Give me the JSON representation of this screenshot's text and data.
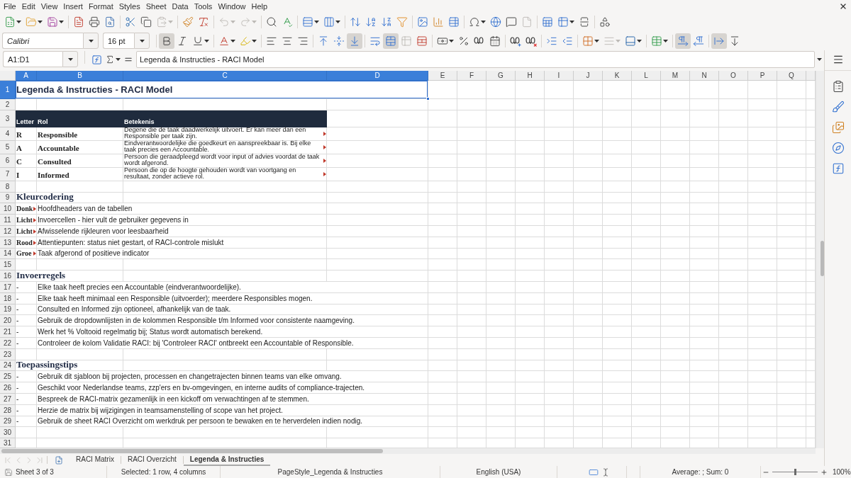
{
  "menu_bar": {
    "items": [
      "File",
      "Edit",
      "View",
      "Insert",
      "Format",
      "Styles",
      "Sheet",
      "Data",
      "Tools",
      "Window",
      "Help"
    ]
  },
  "standard_toolbar": {
    "paste_enabled": false,
    "undo_enabled": false,
    "redo_enabled": false,
    "page_enabled": false
  },
  "formatting_toolbar": {
    "font_name": "Calibri",
    "font_size": "16 pt",
    "bold": true,
    "italic": false,
    "underline": false,
    "align_left": false,
    "align_center": false,
    "align_right": false,
    "align_top": false,
    "align_middle": false,
    "align_bottom": true,
    "wrap_text": false,
    "merge_center": true,
    "merge_enabled": false,
    "border_style_enabled": false,
    "left_to_right": true,
    "right_to_left": false,
    "text_horizontal": true,
    "text_vertical": false
  },
  "formula_bar": {
    "name_box": "A1:D1",
    "formula": "Legenda & Instructies - RACI Model"
  },
  "sheet": {
    "columns": [
      {
        "label": "A",
        "selected": true
      },
      {
        "label": "B",
        "selected": true
      },
      {
        "label": "C",
        "selected": true
      },
      {
        "label": "D",
        "selected": true
      },
      {
        "label": "E",
        "selected": false
      },
      {
        "label": "F",
        "selected": false
      },
      {
        "label": "G",
        "selected": false
      },
      {
        "label": "H",
        "selected": false
      },
      {
        "label": "I",
        "selected": false
      },
      {
        "label": "J",
        "selected": false
      },
      {
        "label": "K",
        "selected": false
      },
      {
        "label": "L",
        "selected": false
      },
      {
        "label": "M",
        "selected": false
      },
      {
        "label": "N",
        "selected": false
      },
      {
        "label": "O",
        "selected": false
      },
      {
        "label": "P",
        "selected": false
      },
      {
        "label": "Q",
        "selected": false
      }
    ],
    "rows": [
      {
        "number": "1",
        "selected": true,
        "kind": "title",
        "text": "Legenda & Instructies - RACI Model"
      },
      {
        "number": "2",
        "selected": false,
        "kind": "blank"
      },
      {
        "number": "3",
        "selected": false,
        "kind": "table_header",
        "cells": [
          "Letter",
          "Rol",
          "Betekenis"
        ]
      },
      {
        "number": "4",
        "selected": false,
        "kind": "role",
        "letter": "R",
        "role": "Responsible",
        "meaning": "Degene die de taak daadwerkelijk uitvoert. Er kan meer dan een Responsible per taak zijn.",
        "clipped": true
      },
      {
        "number": "5",
        "selected": false,
        "kind": "role",
        "letter": "A",
        "role": "Accountable",
        "meaning": "Eindverantwoordelijke die goedkeurt en aanspreekbaar is. Bij elke taak precies een Accountable.",
        "clipped": true
      },
      {
        "number": "6",
        "selected": false,
        "kind": "role",
        "letter": "C",
        "role": "Consulted",
        "meaning": "Persoon die geraadpleegd wordt voor input of advies voordat de taak wordt afgerond.",
        "clipped": true
      },
      {
        "number": "7",
        "selected": false,
        "kind": "role",
        "letter": "I",
        "role": "Informed",
        "meaning": "Persoon die op de hoogte gehouden wordt van voortgang en resultaat, zonder actieve rol.",
        "clipped": true
      },
      {
        "number": "8",
        "selected": false,
        "kind": "blank"
      },
      {
        "number": "9",
        "selected": false,
        "kind": "section",
        "text": "Kleurcodering"
      },
      {
        "number": "10",
        "selected": false,
        "kind": "color_key",
        "label": "Donk",
        "description": "Hoofdheaders van de tabellen",
        "clipped": true
      },
      {
        "number": "11",
        "selected": false,
        "kind": "color_key",
        "label": "Licht",
        "description": "Invoercellen - hier vult de gebruiker gegevens in",
        "clipped": true
      },
      {
        "number": "12",
        "selected": false,
        "kind": "color_key",
        "label": "Licht",
        "description": "Afwisselende rijkleuren voor leesbaarheid",
        "clipped": true
      },
      {
        "number": "13",
        "selected": false,
        "kind": "color_key",
        "label": "Rood",
        "description": "Attentiepunten: status niet gestart, of RACI-controle mislukt",
        "clipped": true
      },
      {
        "number": "14",
        "selected": false,
        "kind": "color_key",
        "label": "Groe",
        "description": "Taak afgerond of positieve indicator",
        "clipped": true
      },
      {
        "number": "15",
        "selected": false,
        "kind": "blank"
      },
      {
        "number": "16",
        "selected": false,
        "kind": "section",
        "text": "Invoerregels"
      },
      {
        "number": "17",
        "selected": false,
        "kind": "bullet",
        "marker": "-",
        "text": "Elke taak heeft precies een Accountable (eindverantwoordelijke)."
      },
      {
        "number": "18",
        "selected": false,
        "kind": "bullet",
        "marker": "-",
        "text": "Elke taak heeft minimaal een Responsible (uitvoerder); meerdere Responsibles mogen."
      },
      {
        "number": "19",
        "selected": false,
        "kind": "bullet",
        "marker": "-",
        "text": "Consulted en Informed zijn optioneel, afhankelijk van de taak."
      },
      {
        "number": "20",
        "selected": false,
        "kind": "bullet",
        "marker": "-",
        "text": "Gebruik de dropdownlijsten in de kolommen Responsible t/m Informed voor consistente naamgeving."
      },
      {
        "number": "21",
        "selected": false,
        "kind": "bullet",
        "marker": "-",
        "text": "Werk het % Voltooid regelmatig bij; Status wordt automatisch berekend."
      },
      {
        "number": "22",
        "selected": false,
        "kind": "bullet",
        "marker": "-",
        "text": "Controleer de kolom Validatie RACI: bij 'Controleer RACI' ontbreekt een Accountable of Responsible."
      },
      {
        "number": "23",
        "selected": false,
        "kind": "blank"
      },
      {
        "number": "24",
        "selected": false,
        "kind": "section",
        "text": "Toepassingstips"
      },
      {
        "number": "25",
        "selected": false,
        "kind": "bullet",
        "marker": "-",
        "text": "Gebruik dit sjabloon bij projecten, processen en changetrajecten binnen teams van elke omvang."
      },
      {
        "number": "26",
        "selected": false,
        "kind": "bullet",
        "marker": "-",
        "text": "Geschikt voor Nederlandse teams, zzp'ers en bv-omgevingen, en interne audits of compliance-trajecten."
      },
      {
        "number": "27",
        "selected": false,
        "kind": "bullet",
        "marker": "-",
        "text": "Bespreek de RACI-matrix gezamenlijk in een kickoff om verwachtingen af te stemmen."
      },
      {
        "number": "28",
        "selected": false,
        "kind": "bullet",
        "marker": "-",
        "text": "Herzie de matrix bij wijzigingen in teamsamenstelling of scope van het project."
      },
      {
        "number": "29",
        "selected": false,
        "kind": "bullet",
        "marker": "-",
        "text": "Gebruik de sheet RACI Overzicht om werkdruk per persoon te bewaken en te herverdelen indien nodig."
      },
      {
        "number": "30",
        "selected": false,
        "kind": "blank"
      },
      {
        "number": "31",
        "selected": false,
        "kind": "blank"
      }
    ]
  },
  "sheet_tabs": {
    "navigation_enabled": false,
    "tabs": [
      {
        "label": "RACI Matrix",
        "selected": false
      },
      {
        "label": "RACI Overzicht",
        "selected": false
      },
      {
        "label": "Legenda & Instructies",
        "selected": true
      }
    ]
  },
  "status_bar": {
    "sheet_position": "Sheet 3 of 3",
    "selection": "Selected: 1 row, 4 columns",
    "page_style": "PageStyle_Legenda & Instructies",
    "language": "English (USA)",
    "summary": "Average: ; Sum: 0",
    "zoom": {
      "level": 0.5,
      "reading": "100%"
    }
  }
}
